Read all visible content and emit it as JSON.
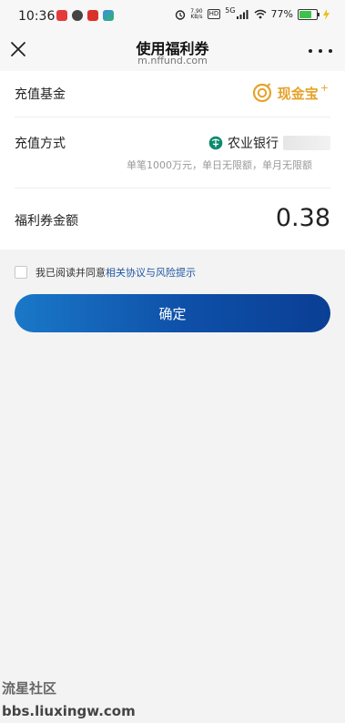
{
  "status_bar": {
    "time": "10:36",
    "net_speed_value": "7.90",
    "net_speed_unit": "KB/s",
    "hd": "HD",
    "signal": "5G",
    "battery": "77%",
    "battery_level": 0.77,
    "icons": [
      "app-icon-red",
      "wechat-icon",
      "app-icon-red2",
      "gallery-icon",
      "alarm-icon",
      "signal-icon",
      "wifi-icon",
      "battery-icon",
      "charging-icon"
    ]
  },
  "nav": {
    "title": "使用福利券",
    "url": "m.nffund.com"
  },
  "form": {
    "fund_label": "充值基金",
    "fund_name": "现金宝",
    "fund_plus": "+",
    "method_label": "充值方式",
    "bank_name": "农业银行",
    "bank_limit": "单笔1000万元，单日无限额，单月无限额",
    "amount_label": "福利券金额",
    "amount_value": "0.38"
  },
  "agreement": {
    "text": "我已阅读并同意",
    "link": "相关协议与风险提示"
  },
  "confirm_label": "确定",
  "watermark": {
    "line1": "流星社区",
    "line2": "bbs.liuxingw.com"
  },
  "colors": {
    "fund_gold": "#e6a22a",
    "link_blue": "#1e56a0",
    "button_blue": "#0e4fa8",
    "bank_green": "#0b8b6d"
  }
}
